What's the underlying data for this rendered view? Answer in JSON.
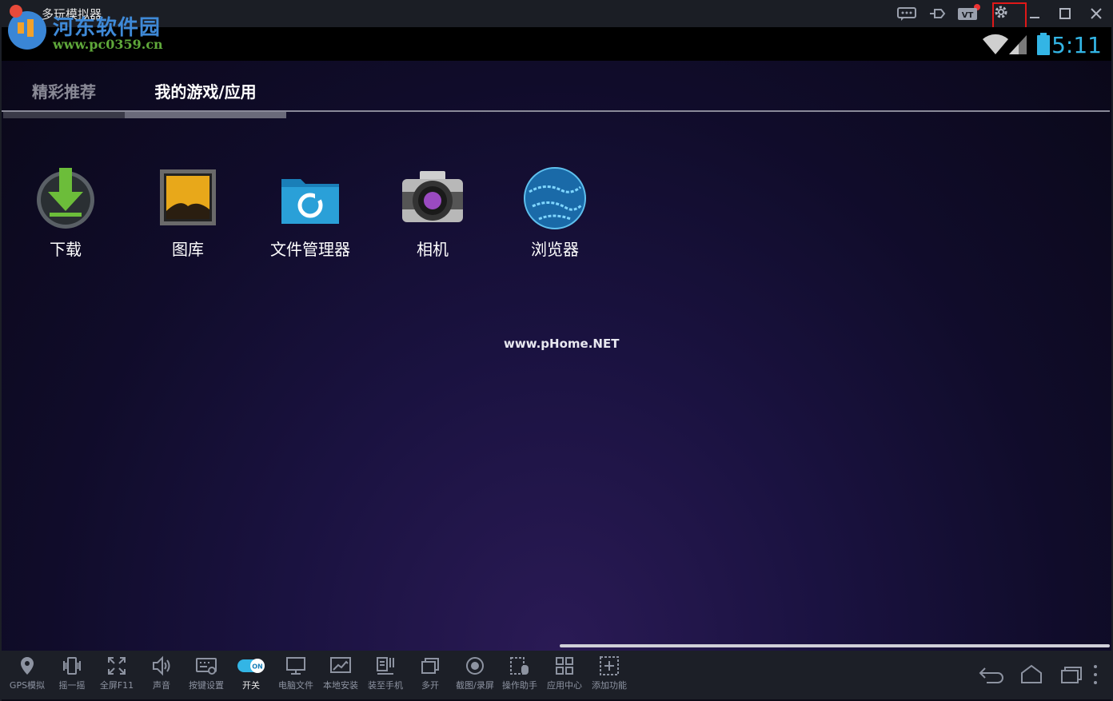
{
  "window": {
    "title": "多玩模拟器",
    "watermark_cn": "河东软件园",
    "watermark_url": "www.pc0359.cn"
  },
  "statusbar": {
    "time": "5:11"
  },
  "tabs": [
    {
      "label": "精彩推荐",
      "active": false
    },
    {
      "label": "我的游戏/应用",
      "active": true
    }
  ],
  "apps": [
    {
      "label": "下载",
      "icon": "download-icon"
    },
    {
      "label": "图库",
      "icon": "gallery-icon"
    },
    {
      "label": "文件管理器",
      "icon": "file-manager-icon"
    },
    {
      "label": "相机",
      "icon": "camera-icon"
    },
    {
      "label": "浏览器",
      "icon": "browser-icon"
    }
  ],
  "center_watermark": "www.pHome.NET",
  "toolbar": [
    {
      "label": "GPS模拟",
      "icon": "location-pin-icon"
    },
    {
      "label": "摇一摇",
      "icon": "shake-icon"
    },
    {
      "label": "全屏F11",
      "icon": "fullscreen-icon"
    },
    {
      "label": "声音",
      "icon": "speaker-icon"
    },
    {
      "label": "按键设置",
      "icon": "keyboard-settings-icon"
    },
    {
      "label": "开关",
      "icon": "toggle-on-icon",
      "toggle_text": "ON"
    },
    {
      "label": "电脑文件",
      "icon": "monitor-icon"
    },
    {
      "label": "本地安装",
      "icon": "install-icon"
    },
    {
      "label": "装至手机",
      "icon": "phone-install-icon"
    },
    {
      "label": "多开",
      "icon": "multi-window-icon"
    },
    {
      "label": "截图/录屏",
      "icon": "record-icon"
    },
    {
      "label": "操作助手",
      "icon": "operation-helper-icon"
    },
    {
      "label": "应用中心",
      "icon": "app-center-icon"
    },
    {
      "label": "添加功能",
      "icon": "add-function-icon"
    }
  ],
  "colors": {
    "accent": "#33b5e5",
    "highlight_box": "#e01818",
    "titlebar": "#1b1e25"
  }
}
